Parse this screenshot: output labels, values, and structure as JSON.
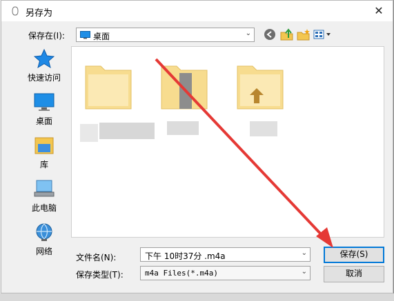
{
  "window": {
    "title": "另存为",
    "close_glyph": "✕"
  },
  "location": {
    "label": "保存在(I):",
    "value": "桌面"
  },
  "toolbar": {
    "icons": [
      "back-icon",
      "up-folder-icon",
      "new-folder-icon",
      "view-menu-icon"
    ]
  },
  "sidebar": {
    "items": [
      {
        "label": "快速访问",
        "icon": "star-icon"
      },
      {
        "label": "桌面",
        "icon": "desktop-icon"
      },
      {
        "label": "库",
        "icon": "library-icon"
      },
      {
        "label": "此电脑",
        "icon": "computer-icon"
      },
      {
        "label": "网络",
        "icon": "network-icon"
      }
    ]
  },
  "form": {
    "filename_label": "文件名(N):",
    "filename_value": "下午 10时37分 .m4a",
    "filetype_label": "保存类型(T):",
    "filetype_value": "m4a Files(*.m4a)"
  },
  "buttons": {
    "save": "保存(S)",
    "cancel": "取消"
  },
  "annotation": {
    "color": "#e53935"
  }
}
